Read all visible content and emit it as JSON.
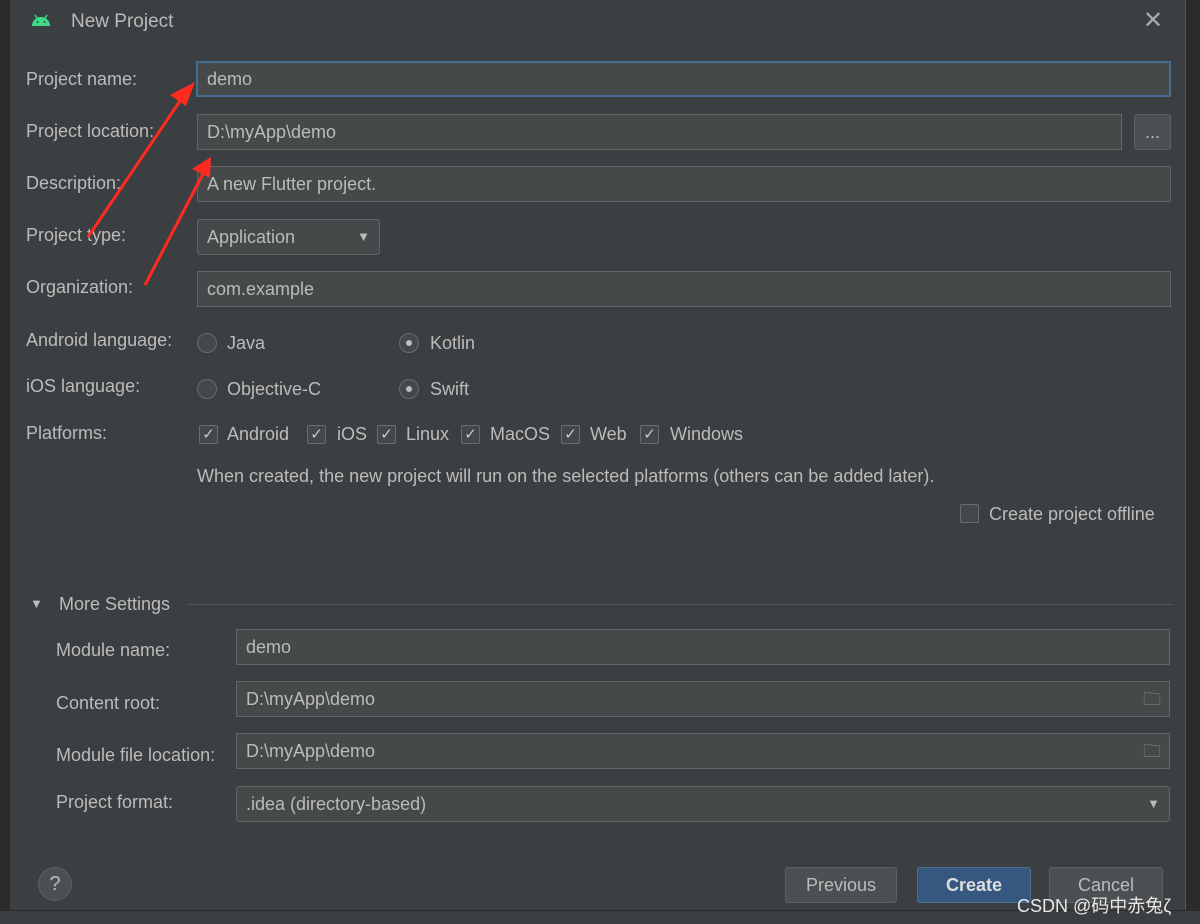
{
  "window": {
    "title": "New Project",
    "icon": "android-icon",
    "close_icon": "close-icon"
  },
  "form": {
    "project_name": {
      "label": "Project name:",
      "value": "demo"
    },
    "project_location": {
      "label": "Project location:",
      "value": "D:\\myApp\\demo",
      "browse_label": "..."
    },
    "description": {
      "label": "Description:",
      "value": "A new Flutter project."
    },
    "project_type": {
      "label": "Project type:",
      "value": "Application"
    },
    "organization": {
      "label": "Organization:",
      "value": "com.example"
    },
    "android_language": {
      "label": "Android language:",
      "options": [
        "Java",
        "Kotlin"
      ],
      "selected": "Kotlin"
    },
    "ios_language": {
      "label": "iOS language:",
      "options": [
        "Objective-C",
        "Swift"
      ],
      "selected": "Swift"
    },
    "platforms": {
      "label": "Platforms:",
      "items": [
        {
          "label": "Android",
          "checked": true
        },
        {
          "label": "iOS",
          "checked": true
        },
        {
          "label": "Linux",
          "checked": true
        },
        {
          "label": "MacOS",
          "checked": true
        },
        {
          "label": "Web",
          "checked": true
        },
        {
          "label": "Windows",
          "checked": true
        }
      ]
    },
    "platforms_hint": "When created, the new project will run on the selected platforms (others can be added later).",
    "offline": {
      "label": "Create project offline",
      "checked": false
    }
  },
  "more_settings": {
    "title": "More Settings",
    "expanded": true,
    "module_name": {
      "label": "Module name:",
      "value": "demo"
    },
    "content_root": {
      "label": "Content root:",
      "value": "D:\\myApp\\demo"
    },
    "module_file_location": {
      "label": "Module file location:",
      "value": "D:\\myApp\\demo"
    },
    "project_format": {
      "label": "Project format:",
      "value": ".idea (directory-based)"
    }
  },
  "footer": {
    "help": "?",
    "previous": "Previous",
    "create": "Create",
    "cancel": "Cancel"
  },
  "watermark": "CSDN @码中赤兔ζ",
  "colors": {
    "accent": "#365880",
    "focus_border": "#466d94",
    "annotation_arrow": "#ff2a1f",
    "android_green": "#3ddc84"
  }
}
